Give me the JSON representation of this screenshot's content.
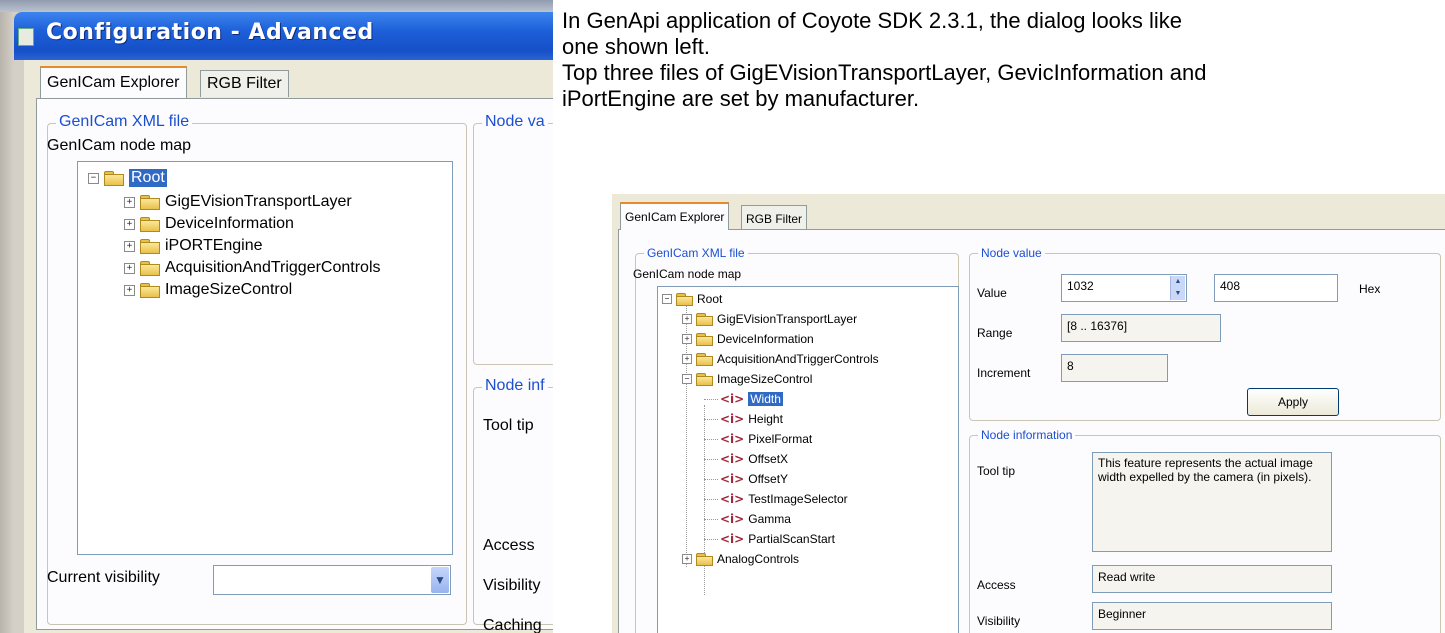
{
  "dialog": {
    "title": "Configuration - Advanced",
    "tabs": [
      "GenICam Explorer",
      "RGB Filter"
    ],
    "xml_group_label": "GenICam XML file",
    "node_map_label": "GenICam node map",
    "tree": [
      {
        "label": "Root",
        "expander": "⊟",
        "selected": true
      },
      {
        "label": "GigEVisionTransportLayer",
        "expander": "⊞"
      },
      {
        "label": "DeviceInformation",
        "expander": "⊞"
      },
      {
        "label": "iPORTEngine",
        "expander": "⊞"
      },
      {
        "label": "AcquisitionAndTriggerControls",
        "expander": "⊞"
      },
      {
        "label": "ImageSizeControl",
        "expander": "⊞"
      }
    ],
    "node_value_label": "Node va",
    "node_info_label": "Node inf",
    "tool_tip_label": "Tool tip",
    "access_label": "Access",
    "visibility_label": "Visibility",
    "caching_label": "Caching",
    "current_visibility_label": "Current visibility",
    "current_visibility_value": ""
  },
  "note": {
    "lines": [
      "In GenApi application of Coyote SDK 2.3.1, the dialog looks like",
      "one shown left.",
      "Top three files of GigEVisionTransportLayer, GevicInformation and",
      "iPortEngine are set by manufacturer."
    ]
  },
  "shot": {
    "tabs": [
      "GenICam Explorer",
      "RGB Filter"
    ],
    "xml_group_label": "GenICam XML file",
    "node_map_label": "GenICam node map",
    "tree": {
      "root": "Root",
      "folders": [
        "GigEVisionTransportLayer",
        "DeviceInformation",
        "AcquisitionAndTriggerControls",
        "ImageSizeControl"
      ],
      "leaf_icon": "<i>",
      "leaves": [
        "Width",
        "Height",
        "PixelFormat",
        "OffsetX",
        "OffsetY",
        "TestImageSelector",
        "Gamma",
        "PartialScanStart"
      ],
      "selected_leaf": "Width",
      "last_folder": "AnalogControls"
    },
    "node_value": {
      "legend": "Node value",
      "value_label": "Value",
      "value": "1032",
      "hex_value": "408",
      "hex_label": "Hex",
      "range_label": "Range",
      "range": "[8 .. 16376]",
      "increment_label": "Increment",
      "increment": "8",
      "apply_label": "Apply"
    },
    "node_info": {
      "legend": "Node information",
      "tool_tip_label": "Tool tip",
      "tool_tip": "This feature represents the actual image width expelled by the camera (in pixels).",
      "access_label": "Access",
      "access": "Read write",
      "visibility_label": "Visibility",
      "visibility": "Beginner"
    }
  }
}
